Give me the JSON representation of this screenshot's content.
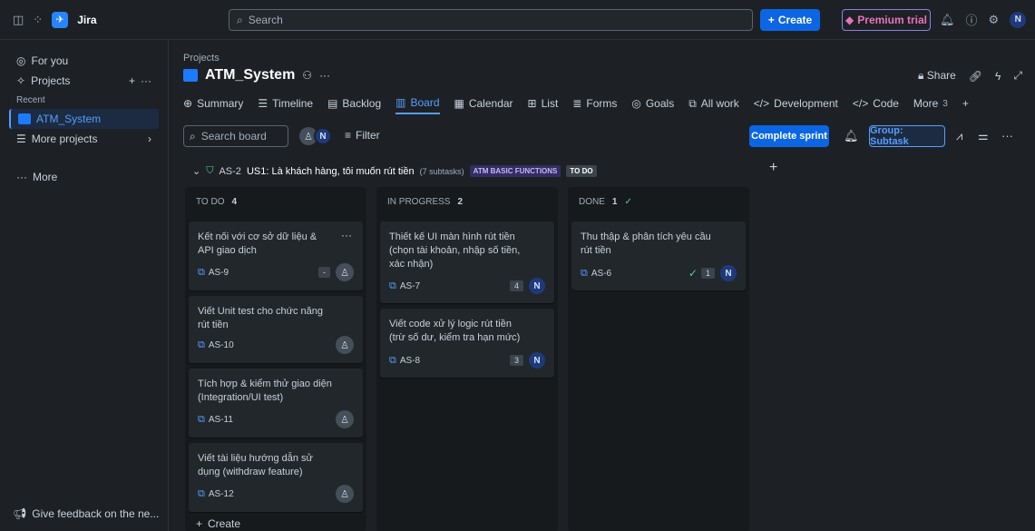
{
  "topbar": {
    "app_name": "Jira",
    "search_placeholder": "Search",
    "create_label": "Create",
    "premium_label": "Premium trial",
    "avatar_initial": "N"
  },
  "sidebar": {
    "for_you": "For you",
    "projects": "Projects",
    "recent": "Recent",
    "active_project": "ATM_System",
    "more_projects": "More projects",
    "more": "More",
    "feedback": "Give feedback on the ne..."
  },
  "header": {
    "breadcrumb": "Projects",
    "title": "ATM_System",
    "share": "Share"
  },
  "tabs": [
    {
      "label": "Summary"
    },
    {
      "label": "Timeline"
    },
    {
      "label": "Backlog"
    },
    {
      "label": "Board"
    },
    {
      "label": "Calendar"
    },
    {
      "label": "List"
    },
    {
      "label": "Forms"
    },
    {
      "label": "Goals"
    },
    {
      "label": "All work"
    },
    {
      "label": "Development"
    },
    {
      "label": "Code"
    },
    {
      "label": "More",
      "count": "3"
    }
  ],
  "toolbar": {
    "search_placeholder": "Search board",
    "avatar_initial": "N",
    "filter": "Filter",
    "complete_sprint": "Complete sprint",
    "group": "Group: Subtask"
  },
  "epic": {
    "key": "AS-2",
    "summary": "US1: Là khách hàng, tôi muốn rút tiền",
    "subtasks": "(7 subtasks)",
    "label": "ATM BASIC FUNCTIONS",
    "status": "TO DO"
  },
  "columns": [
    {
      "name": "TO DO",
      "count": "4",
      "cards": [
        {
          "text": "Kết nối với cơ sở dữ liệu & API giao dịch",
          "key": "AS-9",
          "estimate": "-"
        },
        {
          "text": "Viết Unit test cho chức năng rút tiền",
          "key": "AS-10"
        },
        {
          "text": "Tích hợp & kiểm thử giao diện (Integration/UI test)",
          "key": "AS-11"
        },
        {
          "text": "Viết tài liệu hướng dẫn sử dụng (withdraw feature)",
          "key": "AS-12"
        }
      ],
      "create_label": "Create"
    },
    {
      "name": "IN PROGRESS",
      "count": "2",
      "cards": [
        {
          "text": "Thiết kế UI màn hình rút tiền (chọn tài khoản, nhập số tiền, xác nhận)",
          "key": "AS-7",
          "estimate": "4",
          "assignee": "N"
        },
        {
          "text": "Viết code xử lý logic rút tiền (trừ số dư, kiểm tra hạn mức)",
          "key": "AS-8",
          "estimate": "3",
          "assignee": "N"
        }
      ]
    },
    {
      "name": "DONE",
      "count": "1",
      "cards": [
        {
          "text": "Thu thập & phân tích yêu cầu rút tiền",
          "key": "AS-6",
          "estimate": "1",
          "assignee": "N"
        }
      ]
    }
  ]
}
